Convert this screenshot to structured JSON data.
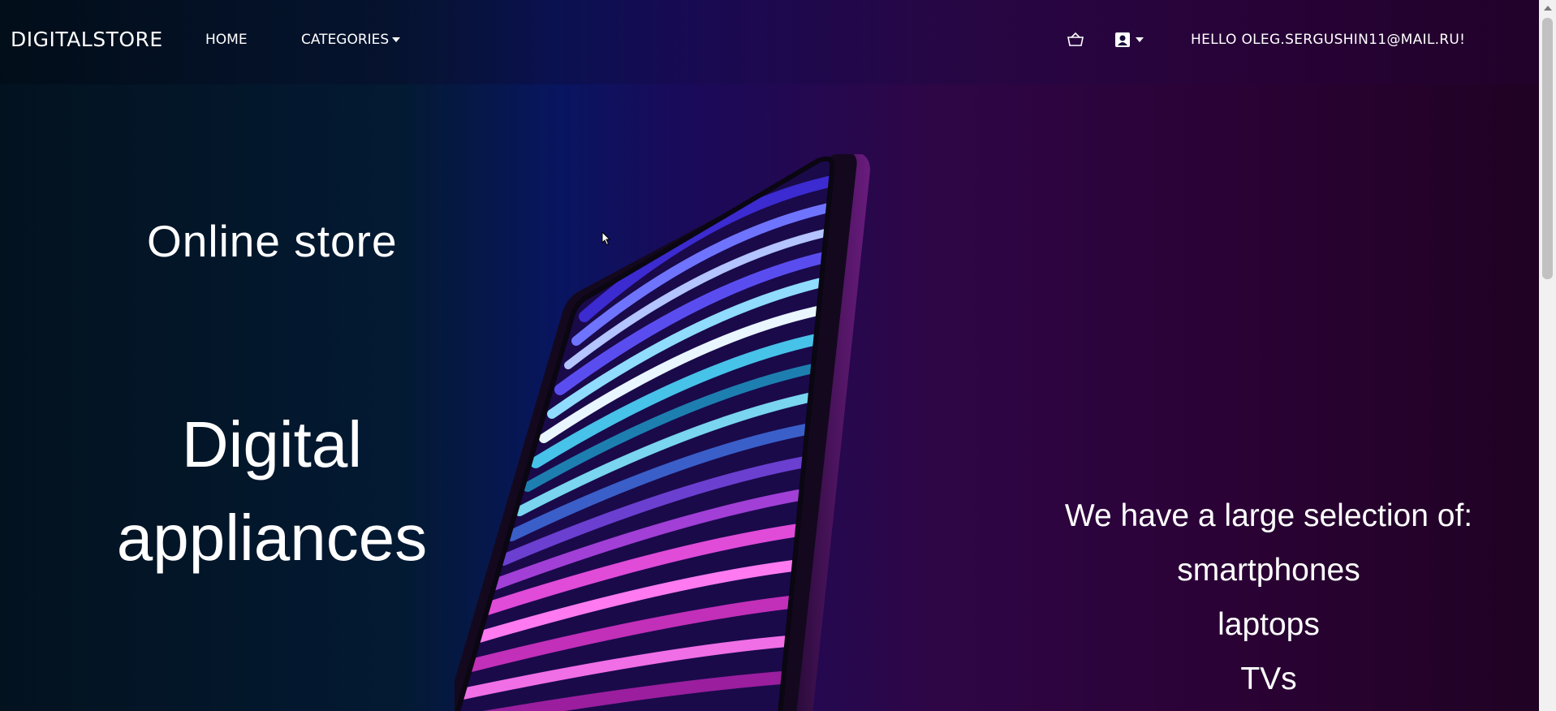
{
  "navbar": {
    "brand": "DIGITALSTORE",
    "home_label": "HOME",
    "categories_label": "CATEGORIES",
    "cart_icon": "basket-icon",
    "account_icon": "user-portrait-icon",
    "greeting": "HELLO OLEG.SERGUSHIN11@MAIL.RU!"
  },
  "hero": {
    "subtitle": "Online store",
    "title_line1": "Digital",
    "title_line2": "appliances",
    "selection_intro": "We have a large selection of:",
    "selection_items": [
      "smartphones",
      "laptops",
      "TVs"
    ]
  },
  "colors": {
    "background_left": "#03121f",
    "background_center": "#081560",
    "background_right": "#2b0236",
    "text": "#ffffff",
    "scrollbar_track": "#f1f1f1",
    "scrollbar_thumb": "#c1c1c1"
  }
}
